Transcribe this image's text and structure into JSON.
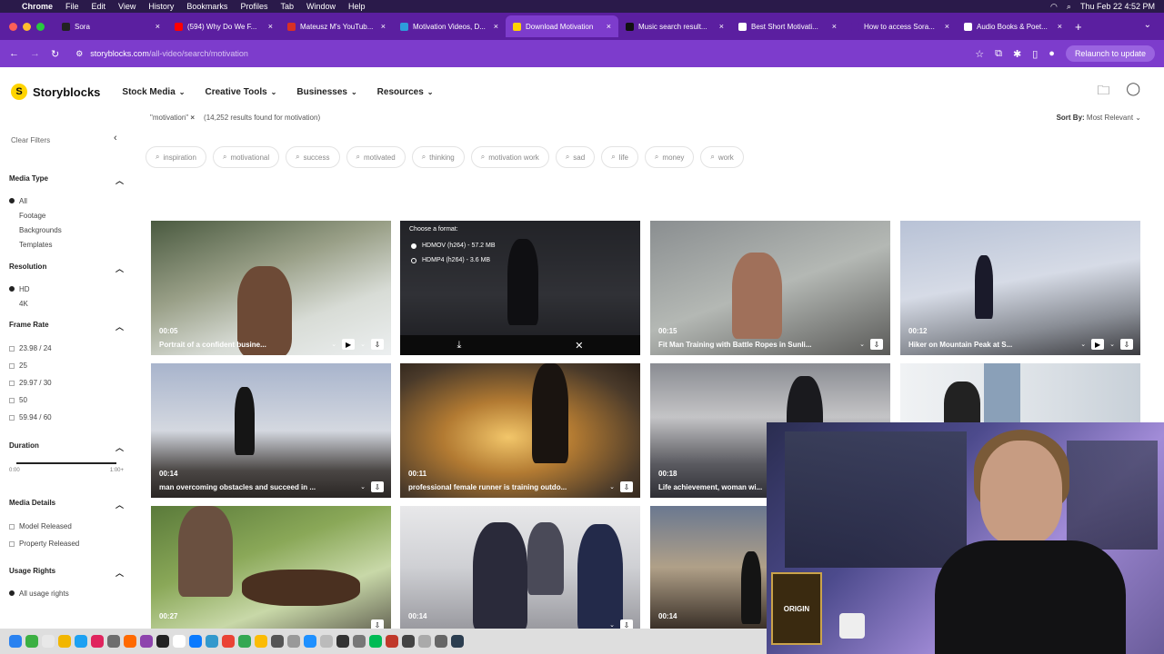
{
  "menubar": {
    "app": "Chrome",
    "items": [
      "File",
      "Edit",
      "View",
      "History",
      "Bookmarks",
      "Profiles",
      "Tab",
      "Window",
      "Help"
    ],
    "clock": "Thu Feb 22  4:52 PM"
  },
  "tabs": [
    {
      "label": "Sora",
      "color": "#222222"
    },
    {
      "label": "(594) Why Do We F...",
      "color": "#ff0000"
    },
    {
      "label": "Mateusz M's YouTub...",
      "color": "#d93025"
    },
    {
      "label": "Motivation Videos, D...",
      "color": "#2d9cdb"
    },
    {
      "label": "Download Motivation",
      "color": "#ffd400",
      "active": true
    },
    {
      "label": "Music search result...",
      "color": "#111111"
    },
    {
      "label": "Best Short Motivati...",
      "color": "#ffffff"
    },
    {
      "label": "How to access Sora...",
      "color": "#5b1fa0"
    },
    {
      "label": "Audio Books & Poet...",
      "color": "#ffffff"
    }
  ],
  "address": {
    "domain": "storyblocks.com",
    "path": "/all-video/search/motivation",
    "relaunch": "Relaunch to update"
  },
  "site": {
    "logo": "Storyblocks",
    "nav": [
      "Stock Media",
      "Creative Tools",
      "Businesses",
      "Resources"
    ]
  },
  "search": {
    "term": "\"motivation\"",
    "results": "(14,252 results found for motivation)",
    "sort_label": "Sort By:",
    "sort_value": "Most Relevant"
  },
  "sidebar": {
    "clear": "Clear Filters",
    "media_type": {
      "title": "Media Type",
      "options": [
        "All",
        "Footage",
        "Backgrounds",
        "Templates"
      ]
    },
    "resolution": {
      "title": "Resolution",
      "options": [
        "HD",
        "4K"
      ]
    },
    "frame_rate": {
      "title": "Frame Rate",
      "options": [
        "23.98 / 24",
        "25",
        "29.97 / 30",
        "50",
        "59.94 / 60"
      ]
    },
    "duration": {
      "title": "Duration",
      "min": "0:00",
      "max": "1:00+"
    },
    "media_details": {
      "title": "Media Details",
      "options": [
        "Model Released",
        "Property Released"
      ]
    },
    "usage_rights": {
      "title": "Usage Rights",
      "options": [
        "All usage rights"
      ]
    }
  },
  "chips": [
    "inspiration",
    "motivational",
    "success",
    "motivated",
    "thinking",
    "motivation work",
    "sad",
    "life",
    "money",
    "work"
  ],
  "overlay": {
    "title": "Choose a format:",
    "formats": [
      "HDMOV (h264) - 57.2 MB",
      "HDMP4 (h264) - 3.6 MB"
    ]
  },
  "videos": [
    {
      "duration": "00:05",
      "title": "Portrait of a confident busine..."
    },
    {
      "duration": "",
      "title": ""
    },
    {
      "duration": "00:15",
      "title": "Fit Man Training with Battle Ropes in Sunli..."
    },
    {
      "duration": "00:12",
      "title": "Hiker on Mountain Peak at S..."
    },
    {
      "duration": "00:14",
      "title": "man overcoming obstacles and succeed in ..."
    },
    {
      "duration": "00:11",
      "title": "professional female runner is training outdo..."
    },
    {
      "duration": "00:18",
      "title": "Life achievement, woman wi..."
    },
    {
      "duration": "",
      "title": ""
    },
    {
      "duration": "00:27",
      "title": ""
    },
    {
      "duration": "00:14",
      "title": ""
    },
    {
      "duration": "00:14",
      "title": ""
    }
  ],
  "webcam": {
    "poster_text": "ORIGIN"
  }
}
